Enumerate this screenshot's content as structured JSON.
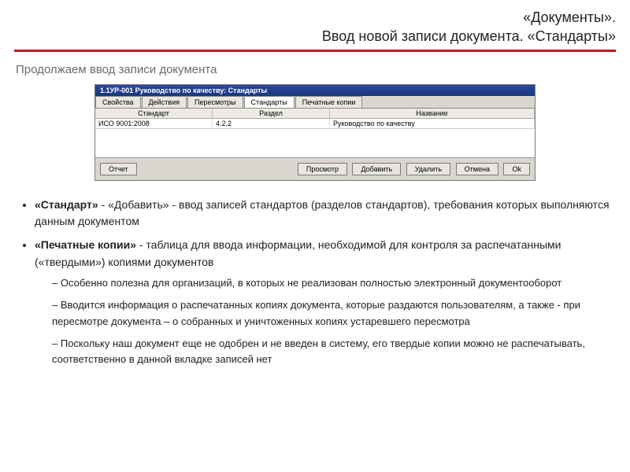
{
  "header": {
    "line1": "«Документы».",
    "line2": "Ввод новой записи документа. «Стандарты»"
  },
  "subcaption": "Продолжаем ввод записи документа",
  "dialog": {
    "title": "1.1УР-001 Руководство по качеству: Стандарты",
    "tabs": [
      "Свойства",
      "Действия",
      "Пересмотры",
      "Стандарты",
      "Печатные копии"
    ],
    "active_tab": 3,
    "columns": [
      "Стандарт",
      "Раздел",
      "Название"
    ],
    "row": {
      "standard": "ИСО 9001:2008",
      "section": "4.2.2",
      "name": "Руководство по качеству"
    },
    "buttons_left": [
      "Отчет"
    ],
    "buttons_right": [
      "Просмотр",
      "Добавить",
      "Удалить",
      "Отмена",
      "Ok"
    ]
  },
  "bullets": {
    "b1_bold": "«Стандарт»",
    "b1_rest": " - «Добавить» - ввод записей стандартов (разделов стандартов), требования которых выполняются данным документом",
    "b2_bold": "«Печатные копии»",
    "b2_rest": " - таблица для ввода информации, необходимой для контроля за распечатанными («твердыми») копиями документов",
    "sub": [
      "Особенно полезна для организаций, в которых не реализован полностью электронный документооборот",
      "Вводится информация о распечатанных копиях документа, которые раздаются пользователям, а также  - при пересмотре документа – о собранных и уничтоженных копиях устаревшего пересмотра",
      "Поскольку наш документ еще не одобрен и не введен в систему, его твердые копии можно не распечатывать, соответственно в данной вкладке записей нет"
    ]
  }
}
